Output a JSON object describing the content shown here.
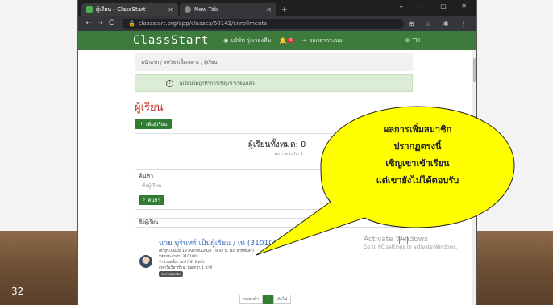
{
  "slide": {
    "number": "32"
  },
  "browser": {
    "tabs": [
      {
        "label": "ผู้เรียน - ClassStart",
        "color": "#4caf50"
      },
      {
        "label": "New Tab",
        "color": "#888888"
      }
    ],
    "url": "classstart.org/app/classes/68142/enrollments"
  },
  "app": {
    "brand": "ClassStart",
    "user": "บริษัท รุ่งเรองทีม",
    "badge_count": "9",
    "logout": "ออกจากระบบ",
    "lang": "TH"
  },
  "page": {
    "breadcrumb": "หน้าแรก / สหวิชาเอื้อเฉพาะ / ผู้เรียน",
    "alert": "ผู้เรียนได้ถูกทำการเชิญเข้าเรียนแล้ว",
    "title": "ผู้เรียน",
    "add_button": "เพิ่มผู้เรียน",
    "total_label": "ผู้เรียนทั้งหมด: 0",
    "total_sub": "รอการตอบรับ: 1",
    "search_label": "ค้นหา",
    "search_placeholder": "ชื่อผู้เรียน",
    "search_button": "ค้นหา",
    "list_header": "ชื่อผู้เรียน",
    "entry": {
      "name": "นาย บุรินทร์ เป็นผู้เรียน / เท่ (3101001)",
      "meta1": "เข้าสู่ระบบเมื่อ 19 กันยายน 2022 19:42 น. (16 นาทีที่แล้ว)",
      "meta2": "รหัสประจำตัว: 3101001",
      "meta3": "จำนวนครั้งการเข้าใช้: 0 ครั้ง",
      "meta4": "เวลาในวิชาเรียน: น้อยกว่า 1 นาที",
      "badge": "รอการตอบรับ"
    },
    "pager": {
      "prev": "ก่อนหน้า",
      "current": "1",
      "next": "ถัดไป"
    }
  },
  "watermark": {
    "title": "Activate Windows",
    "subtitle": "Go to PC settings to activate Windows."
  },
  "callout": {
    "lines": [
      "ผลการเพิ่มสมาชิก",
      "ปรากฏตรงนี้",
      "เชิญเขาเข้าเรียน",
      "แต่เขายังไม่ได้ตอบรับ"
    ],
    "fill": "#ffff00"
  }
}
